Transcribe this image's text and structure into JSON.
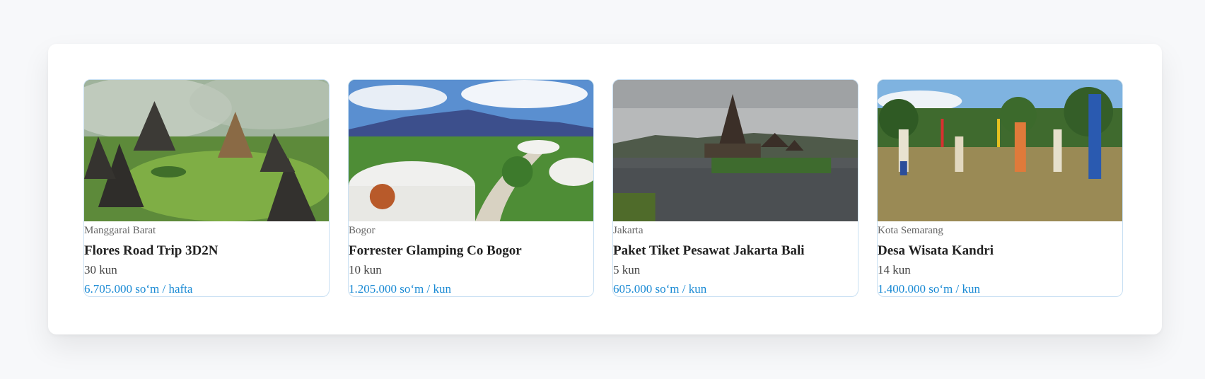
{
  "cards": [
    {
      "location": "Manggarai Barat",
      "title": "Flores Road Trip 3D2N",
      "duration": "30 kun",
      "price": "6.705.000 so‘m / hafta"
    },
    {
      "location": "Bogor",
      "title": "Forrester Glamping Co Bogor",
      "duration": "10 kun",
      "price": "1.205.000 so‘m / kun"
    },
    {
      "location": "Jakarta",
      "title": "Paket Tiket Pesawat Jakarta Bali",
      "duration": "5 kun",
      "price": "605.000 so‘m / kun"
    },
    {
      "location": "Kota Semarang",
      "title": "Desa Wisata Kandri",
      "duration": "14 kun",
      "price": "1.400.000 so‘m / kun"
    }
  ],
  "colors": {
    "accent": "#1a8ad4",
    "border": "#c9e0f3"
  }
}
